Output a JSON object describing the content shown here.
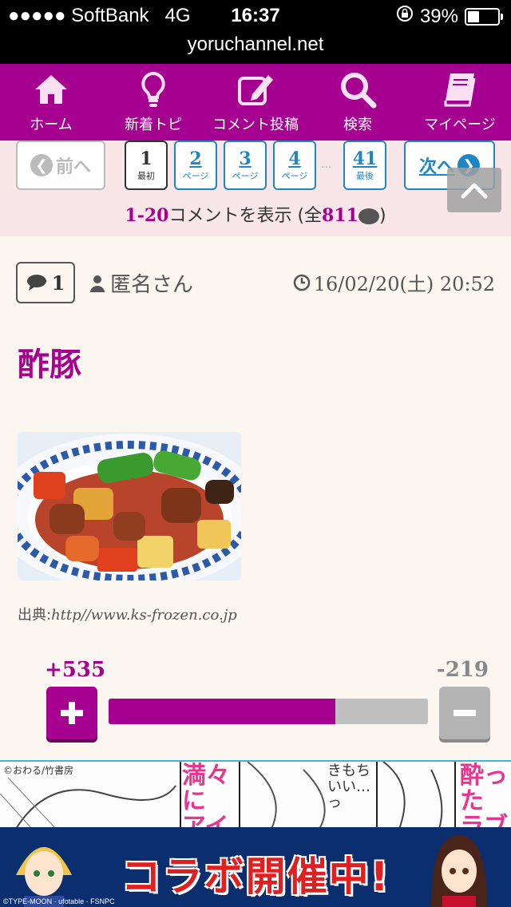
{
  "status_bar": {
    "carrier": "●●●●● SoftBank",
    "network": "4G",
    "time": "16:37",
    "battery": "39%",
    "battery_level": 0.39,
    "url": "yoruchannel.net"
  },
  "nav": [
    {
      "label": "ホーム",
      "icon": "home-icon"
    },
    {
      "label": "新着トピ",
      "icon": "lightbulb-icon"
    },
    {
      "label": "コメント投稿",
      "icon": "edit-icon"
    },
    {
      "label": "検索",
      "icon": "search-icon"
    },
    {
      "label": "マイページ",
      "icon": "book-icon"
    }
  ],
  "pager": {
    "prev_label": "前へ",
    "next_label": "次へ",
    "pages": [
      {
        "num": "1",
        "sub": "最初"
      },
      {
        "num": "2",
        "sub": "ページ"
      },
      {
        "num": "3",
        "sub": "ページ"
      },
      {
        "num": "4",
        "sub": "ページ"
      },
      {
        "num": "41",
        "sub": "最後"
      }
    ],
    "dots": "...",
    "range": "1-20",
    "range_text": "コメントを表示 (全",
    "total": "811",
    "close_paren": ")"
  },
  "comment": {
    "number": "1",
    "author": "匿名さん",
    "date": "16/02/20(土) 20:52",
    "title": "酢豚",
    "source_label": "出典:",
    "source_url": "http//www.ks-frozen.co.jp",
    "plus": "+535",
    "minus": "-219",
    "plus_ratio": 0.71
  },
  "ads": {
    "credit": "©おわる/竹書房",
    "text1": "満々に アイツ",
    "text2": "きもちいい…っ",
    "text3": "酔った ラブホ",
    "banner_text": "コラボ開催中!",
    "copyright": "©TYPE-MOON · ufotable · FSNPC"
  },
  "colors": {
    "brand": "#a5008f",
    "link": "#1f86c6"
  }
}
